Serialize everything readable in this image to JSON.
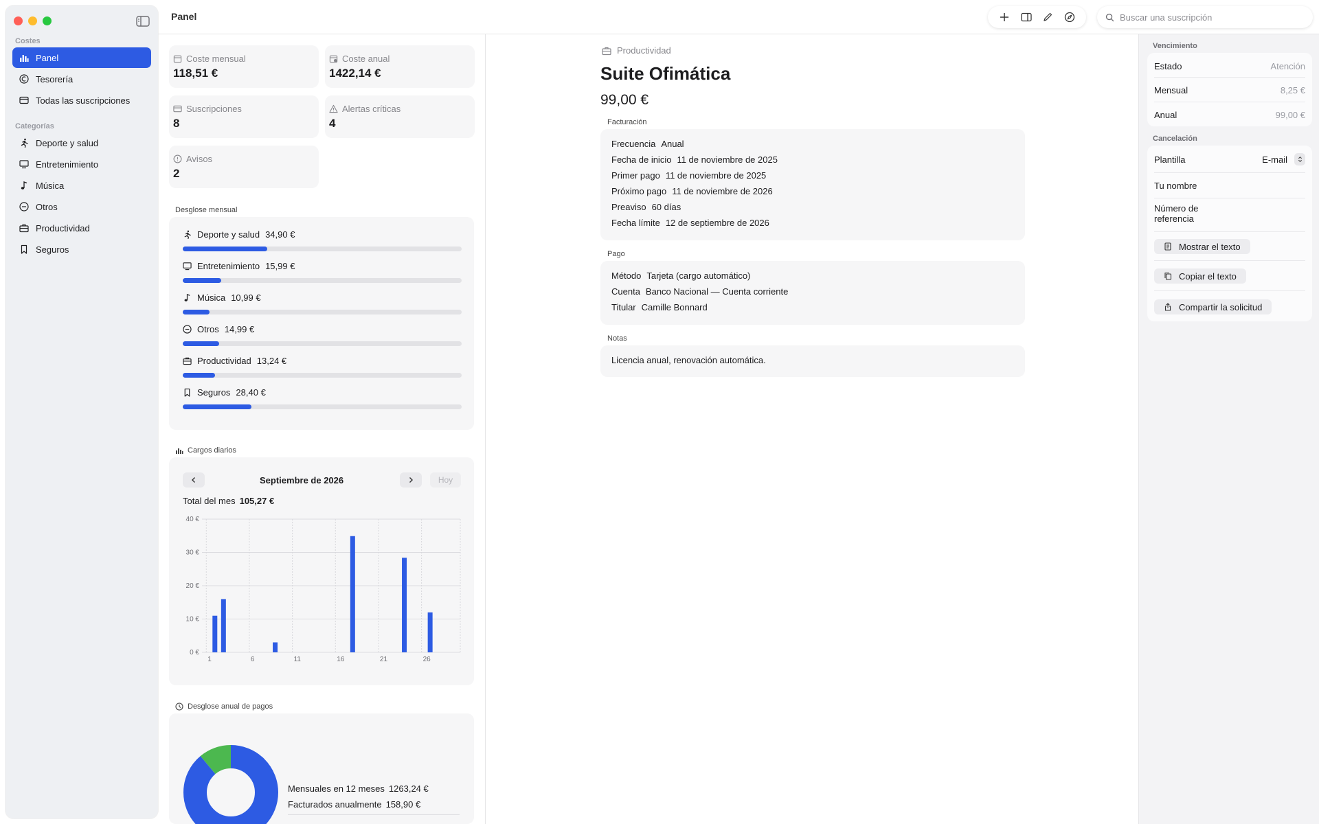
{
  "window": {
    "title": "Panel"
  },
  "sidebar": {
    "sections": [
      {
        "title": "Costes",
        "items": [
          {
            "label": "Panel",
            "icon": "chart-icon",
            "active": true
          },
          {
            "label": "Tesorería",
            "icon": "currency-icon"
          },
          {
            "label": "Todas las suscripciones",
            "icon": "card-icon"
          }
        ]
      },
      {
        "title": "Categorías",
        "items": [
          {
            "label": "Deporte y salud",
            "icon": "runner-icon"
          },
          {
            "label": "Entretenimiento",
            "icon": "tv-icon"
          },
          {
            "label": "Música",
            "icon": "music-note-icon"
          },
          {
            "label": "Otros",
            "icon": "minus-circle-icon"
          },
          {
            "label": "Productividad",
            "icon": "briefcase-icon"
          },
          {
            "label": "Seguros",
            "icon": "bookmark-icon"
          }
        ]
      }
    ]
  },
  "search": {
    "placeholder": "Buscar una suscripción"
  },
  "stats": {
    "monthly": {
      "label": "Coste mensual",
      "value": "118,51 €"
    },
    "yearly": {
      "label": "Coste anual",
      "value": "1422,14 €"
    },
    "subs": {
      "label": "Suscripciones",
      "value": "8"
    },
    "alerts": {
      "label": "Alertas críticas",
      "value": "4"
    },
    "warnings": {
      "label": "Avisos",
      "value": "2"
    }
  },
  "breakdown": {
    "title": "Desglose mensual",
    "max": 115,
    "items": [
      {
        "label": "Deporte y salud",
        "amount": "34,90 €",
        "value": 34.9,
        "icon": "runner-icon"
      },
      {
        "label": "Entretenimiento",
        "amount": "15,99 €",
        "value": 15.99,
        "icon": "tv-icon"
      },
      {
        "label": "Música",
        "amount": "10,99 €",
        "value": 10.99,
        "icon": "music-note-icon"
      },
      {
        "label": "Otros",
        "amount": "14,99 €",
        "value": 14.99,
        "icon": "minus-circle-icon"
      },
      {
        "label": "Productividad",
        "amount": "13,24 €",
        "value": 13.24,
        "icon": "briefcase-icon"
      },
      {
        "label": "Seguros",
        "amount": "28,40 €",
        "value": 28.4,
        "icon": "bookmark-icon"
      }
    ]
  },
  "daily": {
    "title": "Cargos diarios",
    "month": "Septiembre de 2026",
    "today_label": "Hoy",
    "total_label": "Total del mes",
    "total_value": "105,27 €"
  },
  "chart_data": {
    "type": "bar",
    "title": "",
    "xlabel": "",
    "ylabel": "",
    "x": [
      2,
      3,
      9,
      18,
      24,
      27
    ],
    "values": [
      10.99,
      15.99,
      2.99,
      34.9,
      28.4,
      12.0
    ],
    "xlim": [
      0.5,
      30.5
    ],
    "ylim": [
      0,
      40
    ],
    "xticks": [
      1,
      6,
      11,
      16,
      21,
      26
    ],
    "yticks": [
      0,
      10,
      20,
      30,
      40
    ],
    "ytick_labels": [
      "0 €",
      "10 €",
      "20 €",
      "30 €",
      "40 €"
    ],
    "grid": true,
    "color": "#2d5be3"
  },
  "annual": {
    "title": "Desglose anual de pagos",
    "monthly_label": "Mensuales en 12 meses",
    "monthly_value": "1263,24 €",
    "yearly_label": "Facturados anualmente",
    "yearly_value": "158,90 €",
    "colors": {
      "monthly": "#2d5be3",
      "yearly": "#4cb84f"
    }
  },
  "detail": {
    "category": "Productividad",
    "title": "Suite Ofimática",
    "price": "99,00 €",
    "billing": {
      "label": "Facturación",
      "rows": [
        {
          "k": "Frecuencia",
          "v": "Anual"
        },
        {
          "k": "Fecha de inicio",
          "v": "11 de noviembre de 2025"
        },
        {
          "k": "Primer pago",
          "v": "11 de noviembre de 2025"
        },
        {
          "k": "Próximo pago",
          "v": "11 de noviembre de 2026"
        },
        {
          "k": "Preaviso",
          "v": "60 días"
        },
        {
          "k": "Fecha límite",
          "v": "12 de septiembre de 2026"
        }
      ]
    },
    "payment": {
      "label": "Pago",
      "rows": [
        {
          "k": "Método",
          "v": "Tarjeta (cargo automático)"
        },
        {
          "k": "Cuenta",
          "v": "Banco Nacional — Cuenta corriente"
        },
        {
          "k": "Titular",
          "v": "Camille Bonnard"
        }
      ]
    },
    "notes": {
      "label": "Notas",
      "text": "Licencia anual, renovación automática."
    }
  },
  "inspector": {
    "due": {
      "title": "Vencimiento",
      "status_label": "Estado",
      "status_value": "Atención",
      "monthly_label": "Mensual",
      "monthly_value": "8,25 €",
      "yearly_label": "Anual",
      "yearly_value": "99,00 €"
    },
    "cancel": {
      "title": "Cancelación",
      "template_label": "Plantilla",
      "template_value": "E-mail",
      "name_label": "Tu nombre",
      "ref_label_1": "Número de",
      "ref_label_2": "referencia",
      "show_text": "Mostrar el texto",
      "copy_text": "Copiar el texto",
      "share": "Compartir la solicitud"
    }
  }
}
